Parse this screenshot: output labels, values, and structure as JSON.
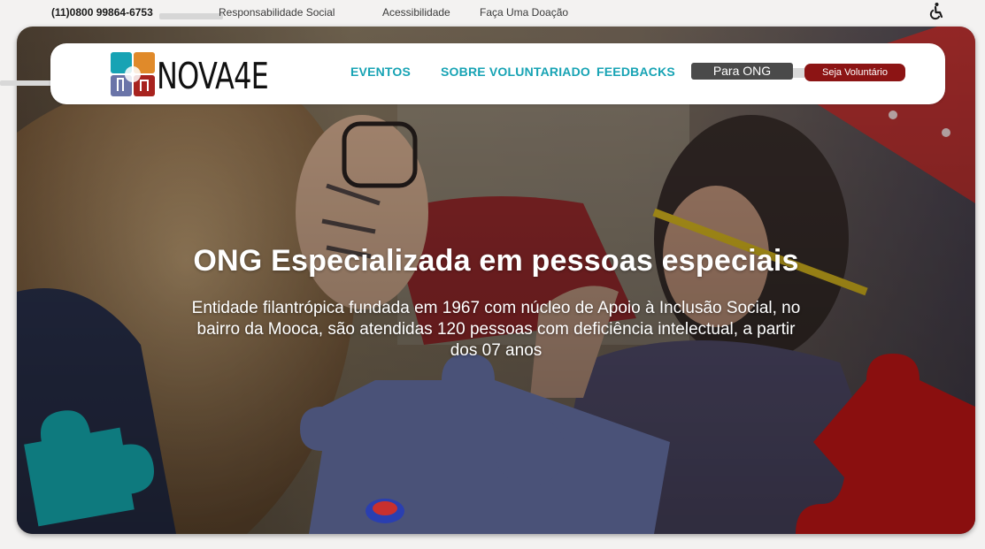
{
  "topbar": {
    "phone": "(11)0800 99864-6753",
    "links": [
      "Responsabilidade Social",
      "Acessibilidade",
      "Faça Uma Doação"
    ],
    "accessibility_icon": "wheelchair-icon"
  },
  "nav": {
    "logo_text": "NOVA4E",
    "links": [
      "EVENTOS",
      "SOBRE VOLUNTARIADO",
      "FEEDBACKS"
    ],
    "button_ong": "Para ONG",
    "button_volunteer": "Seja Voluntário"
  },
  "hero": {
    "title": "ONG Especializada em pessoas especiais",
    "subtitle": "Entidade filantrópica fundada em 1967 com núcleo de Apoio à Inclusão Social, no bairro da Mooca, são atendidas 120 pessoas com deficiência intelectual, a partir dos 07 anos"
  },
  "colors": {
    "brand_teal": "#17a3b4",
    "brand_red": "#8c1414",
    "button_dark": "#4a4a4a",
    "puzzle_teal": "#0e7a7e",
    "puzzle_navy": "#4a5278",
    "puzzle_red": "#8a0f0f"
  }
}
